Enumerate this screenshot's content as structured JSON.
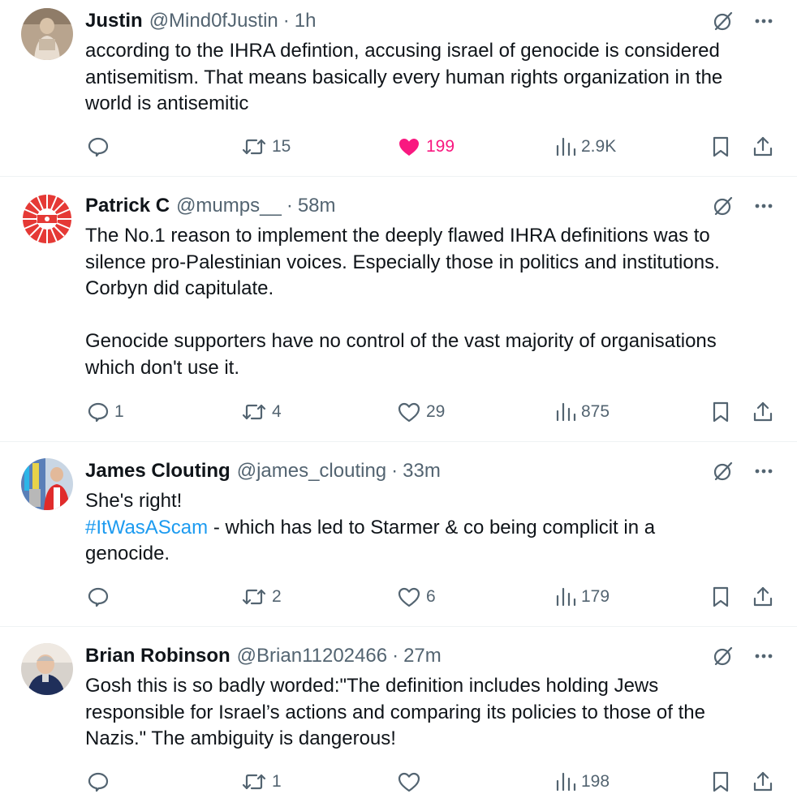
{
  "colors": {
    "text": "#0f1419",
    "secondary": "#536471",
    "link": "#1d9bf0",
    "like_active": "#f91880",
    "divider": "#eff3f4"
  },
  "icons": {
    "grok": "grok-icon",
    "more": "more-icon",
    "reply": "reply-icon",
    "repost": "repost-icon",
    "like": "heart-icon",
    "views": "views-icon",
    "bookmark": "bookmark-icon",
    "share": "share-icon"
  },
  "tweets": [
    {
      "name": "Justin",
      "handle": "@Mind0fJustin",
      "dot": "·",
      "time": "1h",
      "lines": [
        "according to the IHRA defintion, accusing israel of genocide is considered",
        "antisemitism. That means basically every human rights organization in the",
        "world is antisemitic"
      ],
      "replies": "",
      "reposts": "15",
      "likes": "199",
      "liked": true,
      "views": "2.9K"
    },
    {
      "name": "Patrick C",
      "handle": "@mumps__",
      "dot": "·",
      "time": "58m",
      "lines": [
        "The No.1 reason to implement the deeply flawed IHRA definitions was to",
        "silence pro-Palestinian voices. Especially those in politics and institutions.",
        "Corbyn did capitulate."
      ],
      "lines2": [
        "Genocide supporters have no control of the vast majority of organisations",
        "which don't use it."
      ],
      "replies": "1",
      "reposts": "4",
      "likes": "29",
      "liked": false,
      "views": "875"
    },
    {
      "name": "James Clouting",
      "handle": "@james_clouting",
      "dot": "·",
      "time": "33m",
      "line1": "She's right!",
      "hashtag": "#ItWasAScam",
      "line2_rest": " - which has led to Starmer & co being complicit in a",
      "line3": "genocide.",
      "replies": "",
      "reposts": "2",
      "likes": "6",
      "liked": false,
      "views": "179"
    },
    {
      "name": "Brian Robinson",
      "handle": "@Brian11202466",
      "dot": "·",
      "time": "27m",
      "lines": [
        "Gosh this is so badly worded:\"The definition includes holding Jews",
        "responsible for Israel’s actions and comparing its policies to those of the",
        "Nazis.\" The ambiguity is dangerous!"
      ],
      "replies": "",
      "reposts": "1",
      "likes": "",
      "liked": false,
      "views": "198"
    }
  ]
}
